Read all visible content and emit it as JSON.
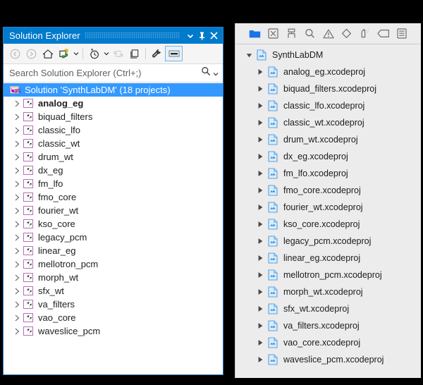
{
  "solution_explorer": {
    "title": "Solution Explorer",
    "titlebar_buttons": [
      {
        "name": "chevron-down-icon",
        "label": "▾"
      },
      {
        "name": "pin-icon",
        "label": "Pin"
      },
      {
        "name": "close-icon",
        "label": "✕"
      }
    ],
    "toolbar": [
      {
        "name": "back-icon",
        "label": "Back"
      },
      {
        "name": "forward-icon",
        "label": "Forward"
      },
      {
        "name": "home-icon",
        "label": "Home"
      },
      {
        "name": "sync-with-active-document-icon",
        "label": "Sync with Active Document"
      },
      {
        "name": "sync-dropdown-caret-icon",
        "label": "▾"
      },
      {
        "name": "pending-changes-icon",
        "label": "Pending Changes Filter"
      },
      {
        "name": "pending-changes-caret-icon",
        "label": "▾"
      },
      {
        "name": "refresh-icon",
        "label": "Refresh"
      },
      {
        "name": "show-all-files-icon",
        "label": "Show All Files"
      },
      {
        "name": "properties-icon",
        "label": "Properties"
      },
      {
        "name": "preview-selected-items-icon",
        "label": "Preview Selected Items"
      }
    ],
    "search": {
      "placeholder": "Search Solution Explorer (Ctrl+;)",
      "value": "",
      "icons": [
        {
          "name": "search-icon",
          "label": "Search"
        },
        {
          "name": "search-options-caret-icon",
          "label": "▾"
        }
      ]
    },
    "tree": {
      "root": {
        "label": "Solution 'SynthLabDM' (18 projects)",
        "icon": "solution-icon",
        "selected": true
      },
      "projects": [
        {
          "label": "analog_eg",
          "bold": true
        },
        {
          "label": "biquad_filters",
          "bold": false
        },
        {
          "label": "classic_lfo",
          "bold": false
        },
        {
          "label": "classic_wt",
          "bold": false
        },
        {
          "label": "drum_wt",
          "bold": false
        },
        {
          "label": "dx_eg",
          "bold": false
        },
        {
          "label": "fm_lfo",
          "bold": false
        },
        {
          "label": "fmo_core",
          "bold": false
        },
        {
          "label": "fourier_wt",
          "bold": false
        },
        {
          "label": "kso_core",
          "bold": false
        },
        {
          "label": "legacy_pcm",
          "bold": false
        },
        {
          "label": "linear_eg",
          "bold": false
        },
        {
          "label": "mellotron_pcm",
          "bold": false
        },
        {
          "label": "morph_wt",
          "bold": false
        },
        {
          "label": "sfx_wt",
          "bold": false
        },
        {
          "label": "va_filters",
          "bold": false
        },
        {
          "label": "vao_core",
          "bold": false
        },
        {
          "label": "waveslice_pcm",
          "bold": false
        }
      ]
    },
    "colors": {
      "titlebar": "#007acc",
      "selection": "#3399ff",
      "project_icon_border": "#b46fb4"
    }
  },
  "xcode_navigator": {
    "toolbar": [
      {
        "name": "project-navigator-icon",
        "label": "Project Navigator",
        "active": true
      },
      {
        "name": "source-control-navigator-icon",
        "label": "Source Control Navigator",
        "active": false
      },
      {
        "name": "symbol-navigator-icon",
        "label": "Symbol Navigator",
        "active": false
      },
      {
        "name": "find-navigator-icon",
        "label": "Find Navigator",
        "active": false
      },
      {
        "name": "issue-navigator-icon",
        "label": "Issue Navigator",
        "active": false
      },
      {
        "name": "test-navigator-icon",
        "label": "Test Navigator",
        "active": false
      },
      {
        "name": "debug-navigator-icon",
        "label": "Debug Navigator",
        "active": false
      },
      {
        "name": "breakpoint-navigator-icon",
        "label": "Breakpoint Navigator",
        "active": false
      },
      {
        "name": "report-navigator-icon",
        "label": "Report Navigator",
        "active": false
      }
    ],
    "tree": {
      "root": {
        "label": "SynthLabDM",
        "icon": "project-file-icon",
        "expanded": true
      },
      "files": [
        {
          "label": "analog_eg.xcodeproj"
        },
        {
          "label": "biquad_filters.xcodeproj"
        },
        {
          "label": "classic_lfo.xcodeproj"
        },
        {
          "label": "classic_wt.xcodeproj"
        },
        {
          "label": "drum_wt.xcodeproj"
        },
        {
          "label": "dx_eg.xcodeproj"
        },
        {
          "label": "fm_lfo.xcodeproj"
        },
        {
          "label": "fmo_core.xcodeproj"
        },
        {
          "label": "fourier_wt.xcodeproj"
        },
        {
          "label": "kso_core.xcodeproj"
        },
        {
          "label": "legacy_pcm.xcodeproj"
        },
        {
          "label": "linear_eg.xcodeproj"
        },
        {
          "label": "mellotron_pcm.xcodeproj"
        },
        {
          "label": "morph_wt.xcodeproj"
        },
        {
          "label": "sfx_wt.xcodeproj"
        },
        {
          "label": "va_filters.xcodeproj"
        },
        {
          "label": "vao_core.xcodeproj"
        },
        {
          "label": "waveslice_pcm.xcodeproj"
        }
      ]
    },
    "colors": {
      "background": "#ececec",
      "active_tool": "#1a73e8",
      "file_icon": "#57a5e8"
    }
  }
}
